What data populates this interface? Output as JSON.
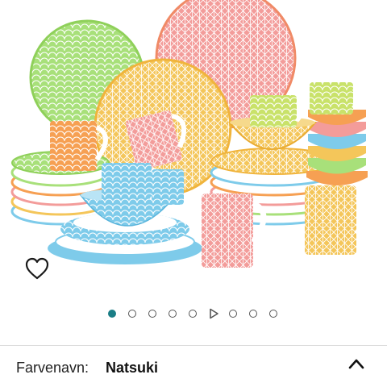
{
  "product_gallery": {
    "image_alt": "Natsuki dinnerware set: plates, bowls and mugs in coloured seigaiha and star patterns",
    "slides": [
      "image",
      "image",
      "image",
      "image",
      "image",
      "video",
      "image",
      "image",
      "image"
    ],
    "active_index": 0,
    "video_icon": "play-icon"
  },
  "favorite": {
    "icon": "heart-outline-icon"
  },
  "variant": {
    "label": "Farvenavn:",
    "value": "Natsuki",
    "toggle_icon": "chevron-up-icon"
  },
  "colors": {
    "accent": "#1b7e86",
    "text": "#222222",
    "divider": "#dcdcdc"
  }
}
